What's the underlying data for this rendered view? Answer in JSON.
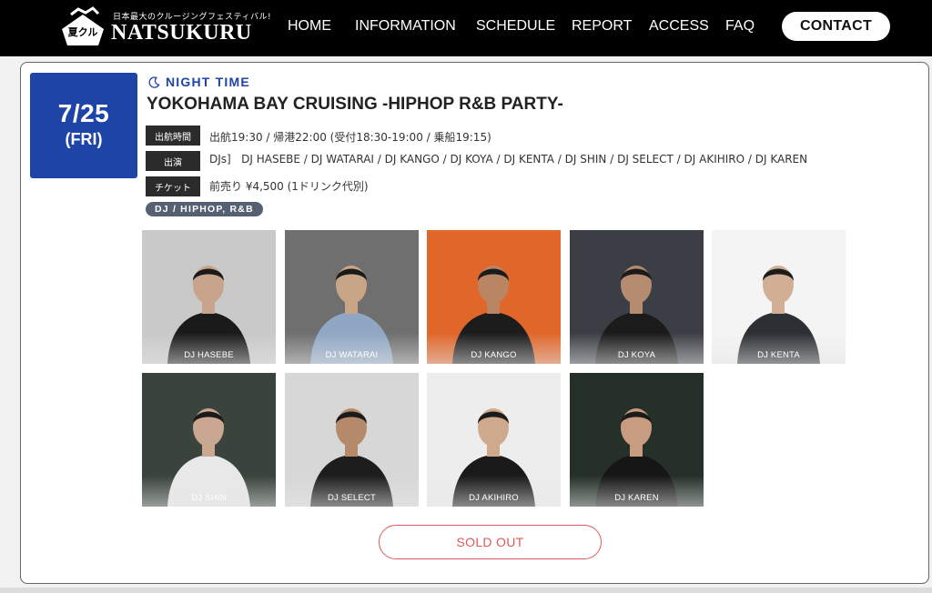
{
  "header": {
    "logo": {
      "mark_text": "夏クル",
      "tagline": "日本最大のクルージングフェスティバル!",
      "wordmark": "NATSUKURU"
    },
    "nav": [
      {
        "label": "HOME"
      },
      {
        "label": "INFORMATION"
      },
      {
        "label": "SCHEDULE"
      },
      {
        "label": "REPORT"
      },
      {
        "label": "ACCESS"
      },
      {
        "label": "FAQ"
      }
    ],
    "contact_label": "CONTACT"
  },
  "event": {
    "date": "7/25",
    "day": "(FRI)",
    "time_of_day": "NIGHT TIME",
    "title": "YOKOHAMA BAY CRUISING -HIPHOP R&B PARTY-",
    "info": [
      {
        "label": "出航時間",
        "value": "出航19:30 / 帰港22:00 (受付18:30-19:00 / 乗船19:15)"
      },
      {
        "label": "出演",
        "value": "DJs]   DJ HASEBE / DJ WATARAI / DJ KANGO / DJ KOYA / DJ KENTA / DJ SHIN / DJ SELECT / DJ AKIHIRO / DJ KAREN"
      },
      {
        "label": "チケット",
        "value": "前売り ¥4,500 (1ドリンク代別)"
      }
    ],
    "genre_tag": "DJ / HIPHOP, R&B",
    "performers": [
      {
        "name": "DJ HASEBE",
        "bg": "#c9c9c9",
        "shirt": "#1a1a1a",
        "skin": "#c8a48c"
      },
      {
        "name": "DJ WATARAI",
        "bg": "#6f6f6f",
        "shirt": "#8fa7c4",
        "skin": "#c9a588"
      },
      {
        "name": "DJ KANGO",
        "bg": "#e0662a",
        "shirt": "#1c1c1c",
        "skin": "#b98563"
      },
      {
        "name": "DJ KOYA",
        "bg": "#3b3f45",
        "shirt": "#1b1b1b",
        "skin": "#b58c70"
      },
      {
        "name": "DJ KENTA",
        "bg": "#f4f4f4",
        "shirt": "#2c2f33",
        "skin": "#d2ae94"
      },
      {
        "name": "DJ SHIN",
        "bg": "#3a443c",
        "shirt": "#e8e8e8",
        "skin": "#c9a790"
      },
      {
        "name": "DJ SELECT",
        "bg": "#d7d7d7",
        "shirt": "#1d1d1d",
        "skin": "#b58a6a"
      },
      {
        "name": "DJ AKIHIRO",
        "bg": "#ededed",
        "shirt": "#1a1a1a",
        "skin": "#cfa98b"
      },
      {
        "name": "DJ KAREN",
        "bg": "#243028",
        "shirt": "#161616",
        "skin": "#c89c80"
      }
    ],
    "status_label": "SOLD OUT"
  },
  "colors": {
    "accent_blue": "#1f44a8",
    "sold_out_red": "#e05858",
    "header_bg": "#000000",
    "tag_bg": "#556173"
  }
}
